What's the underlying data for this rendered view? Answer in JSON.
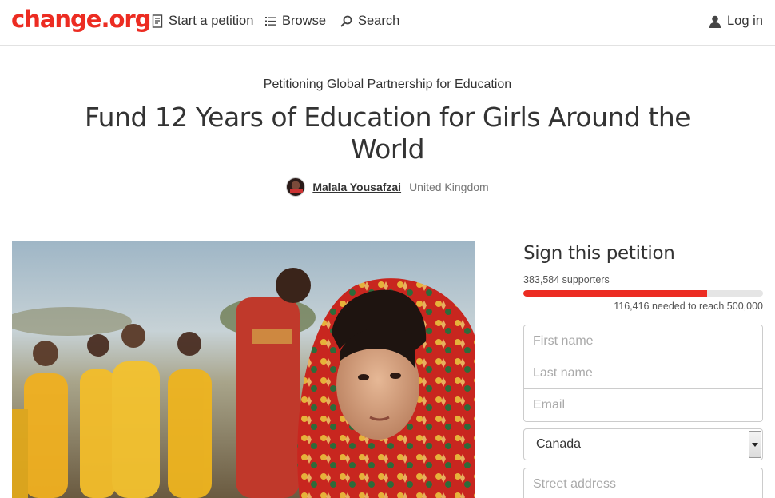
{
  "header": {
    "logo": "change.org",
    "nav": {
      "start": "Start a petition",
      "browse": "Browse",
      "search": "Search",
      "login": "Log in"
    }
  },
  "petition": {
    "petitioning": "Petitioning Global Partnership for Education",
    "title": "Fund 12 Years of Education for Girls Around the World",
    "author": "Malala Yousafzai",
    "location": "United Kingdom"
  },
  "sign": {
    "title": "Sign this petition",
    "supporters": "383,584 supporters",
    "progress_fraction": 0.767,
    "needed": "116,416 needed to reach 500,000",
    "first_name_placeholder": "First name",
    "last_name_placeholder": "Last name",
    "email_placeholder": "Email",
    "country": "Canada",
    "street_placeholder": "Street address"
  },
  "colors": {
    "brand": "#ec2c22",
    "progress_track": "#e5e5e5"
  },
  "icons": {
    "start": "petition-doc-icon",
    "browse": "list-icon",
    "search": "search-icon",
    "login": "user-icon",
    "select": "caret-down-icon"
  }
}
